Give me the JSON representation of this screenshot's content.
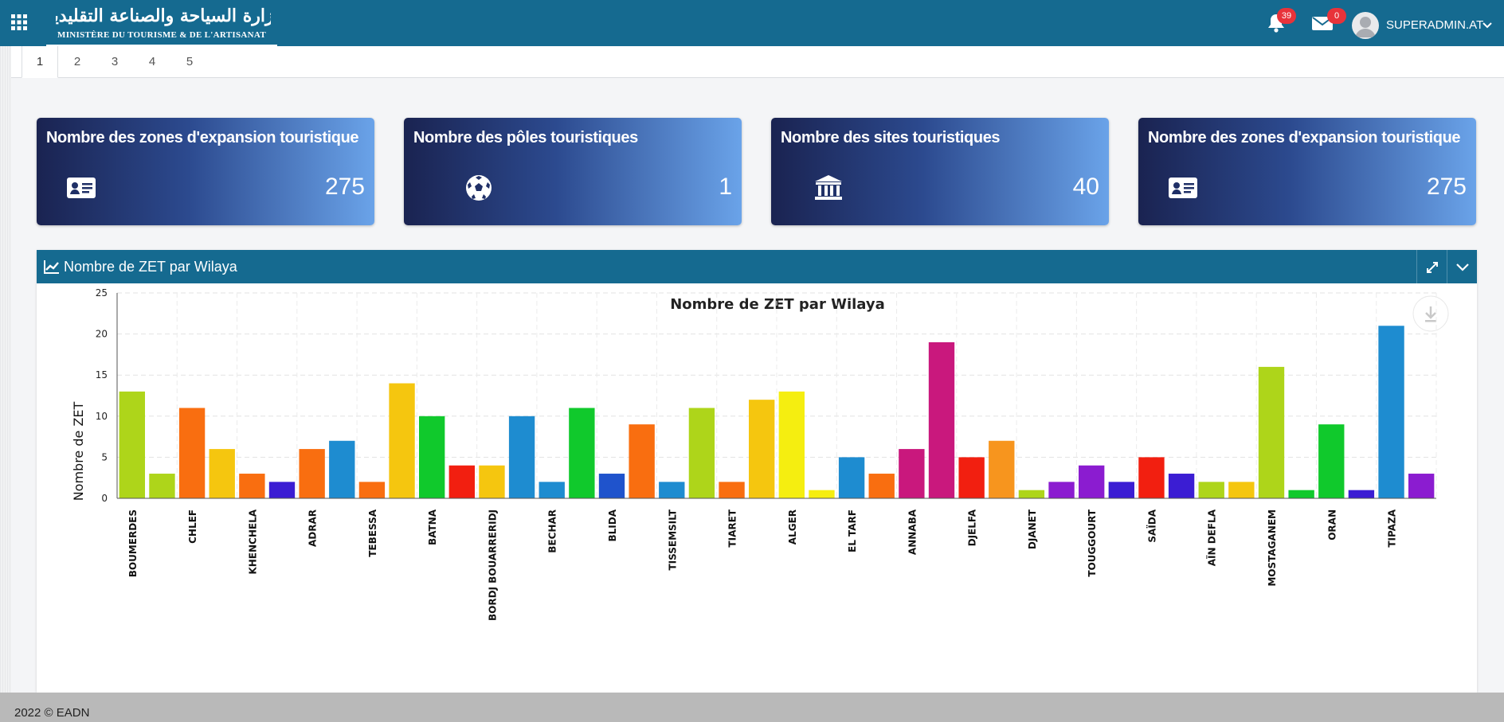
{
  "header": {
    "logo_arabic": "وزارة السياحة والصناعة التقليدية",
    "logo_french": "MINISTÈRE DU TOURISME & DE L'ARTISANAT",
    "notifications_count": "39",
    "messages_count": "0",
    "user_name": "SUPERADMIN.AT",
    "icons": [
      "apps-grid-icon",
      "bell-icon",
      "envelope-icon",
      "avatar-icon",
      "chevron-down-icon"
    ]
  },
  "tabs": [
    {
      "label": "1",
      "active": true
    },
    {
      "label": "2",
      "active": false
    },
    {
      "label": "3",
      "active": false
    },
    {
      "label": "4",
      "active": false
    },
    {
      "label": "5",
      "active": false
    }
  ],
  "cards": [
    {
      "title": "Nombre des zones d'expansion touristique",
      "value": "275",
      "icon": "id-card-icon"
    },
    {
      "title": "Nombre des pôles touristiques",
      "value": "1",
      "icon": "football-icon"
    },
    {
      "title": "Nombre des sites touristiques",
      "value": "40",
      "icon": "museum-icon"
    },
    {
      "title": "Nombre des zones d'expansion touristique",
      "value": "275",
      "icon": "id-card-icon"
    }
  ],
  "panel": {
    "title": "Nombre de ZET par Wilaya",
    "icons": [
      "line-chart-icon",
      "expand-icon",
      "collapse-chevron-icon",
      "download-icon"
    ]
  },
  "chart_data": {
    "type": "bar",
    "title": "Nombre de ZET par Wilaya",
    "xlabel": "",
    "ylabel": "Nombre de ZET",
    "ylim": [
      0,
      25
    ],
    "yticks": [
      0,
      5,
      10,
      15,
      20,
      25
    ],
    "grid": true,
    "categories": [
      "BOUMERDES",
      "",
      "CHLEF",
      "",
      "KHENCHELA",
      "",
      "ADRAR",
      "",
      "TEBESSA",
      "",
      "BATNA",
      "",
      "BORDJ BOUARRERIDJ",
      "",
      "BECHAR",
      "",
      "BLIDA",
      "",
      "TISSEMSILT",
      "",
      "TIARET",
      "",
      "ALGER",
      "",
      "EL TARF",
      "",
      "ANNABA",
      "",
      "DJELFA",
      "",
      "DJANET",
      "",
      "TOUGGOURT",
      "",
      "SAÏDA",
      "",
      "AÏN DEFLA",
      "",
      "MOSTAGANEM",
      "",
      "ORAN",
      "",
      "TIPAZA",
      ""
    ],
    "values": [
      13,
      3,
      11,
      6,
      3,
      2,
      6,
      7,
      2,
      14,
      10,
      4,
      4,
      10,
      2,
      11,
      3,
      9,
      2,
      11,
      2,
      12,
      13,
      1,
      5,
      3,
      6,
      19,
      5,
      7,
      1,
      2,
      4,
      2,
      5,
      3,
      2,
      2,
      16,
      1,
      9,
      1,
      21,
      3
    ],
    "colors": [
      "#aed51a",
      "#aed51a",
      "#f96e10",
      "#f5c60f",
      "#f96e10",
      "#3b1dd3",
      "#f96e10",
      "#1e8cd0",
      "#f96e10",
      "#f5c60f",
      "#10c92c",
      "#f21f10",
      "#f5c60f",
      "#1e8cd0",
      "#1e8cd0",
      "#10c92c",
      "#1f53cc",
      "#f96e10",
      "#1e8cd0",
      "#aed51a",
      "#f96e10",
      "#f5c60f",
      "#f5ee10",
      "#f5ee10",
      "#1e8cd0",
      "#f96e10",
      "#c9187d",
      "#c9187d",
      "#f21f10",
      "#f7951e",
      "#aed51a",
      "#8b1cd0",
      "#8b1cd0",
      "#3b1dd3",
      "#f21f10",
      "#3b1dd3",
      "#aed51a",
      "#f5c60f",
      "#aed51a",
      "#10c92c",
      "#10c92c",
      "#3b1dd3",
      "#1e8cd0",
      "#8b1cd0"
    ]
  },
  "footer": {
    "text": "2022 © EADN"
  }
}
